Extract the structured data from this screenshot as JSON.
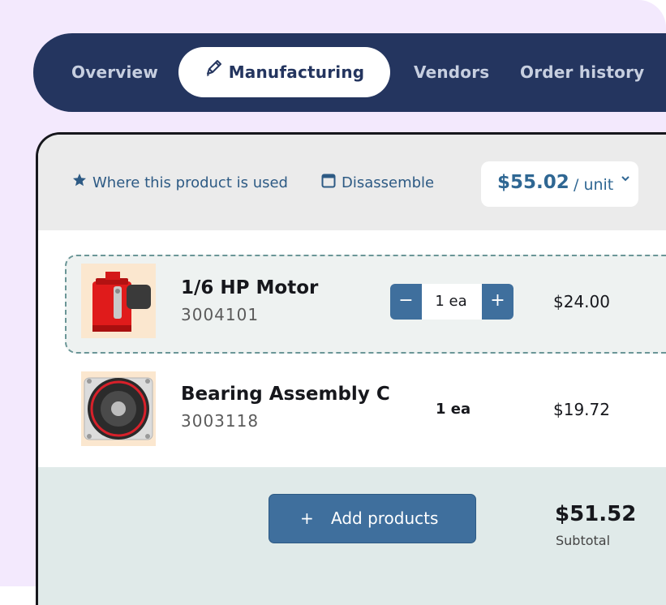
{
  "tabs": [
    {
      "label": "Overview",
      "active": false
    },
    {
      "label": "Manufacturing",
      "active": true,
      "icon": "pencil-icon"
    },
    {
      "label": "Vendors",
      "active": false
    },
    {
      "label": "Order history",
      "active": false
    }
  ],
  "header": {
    "where_used_label": "Where this product is used",
    "where_used_icon": "star-icon",
    "disassemble_label": "Disassemble",
    "disassemble_icon": "calendar-icon",
    "unit_price": "$55.02",
    "unit_suffix": "/ unit"
  },
  "products": [
    {
      "name": "1/6 HP Motor",
      "sku": "3004101",
      "quantity": "1 ea",
      "amount": "$24.00",
      "editable_quantity": true,
      "image": "red-motor-image"
    },
    {
      "name": "Bearing Assembly C",
      "sku": "3003118",
      "quantity": "1 ea",
      "amount": "$19.72",
      "editable_quantity": false,
      "image": "bearing-assembly-image"
    }
  ],
  "stepper": {
    "minus": "−",
    "plus": "+"
  },
  "footer": {
    "add_icon": "+",
    "add_label": "Add products",
    "subtotal_value": "$51.52",
    "subtotal_label": "Subtotal"
  },
  "colors": {
    "navy": "#24355f",
    "accent_blue": "#3f6f9d",
    "page_bg": "#f3e9fd",
    "row_highlight": "#eef2f1",
    "dashed_border": "#6b9697",
    "footer_bg": "#e0eae9"
  }
}
